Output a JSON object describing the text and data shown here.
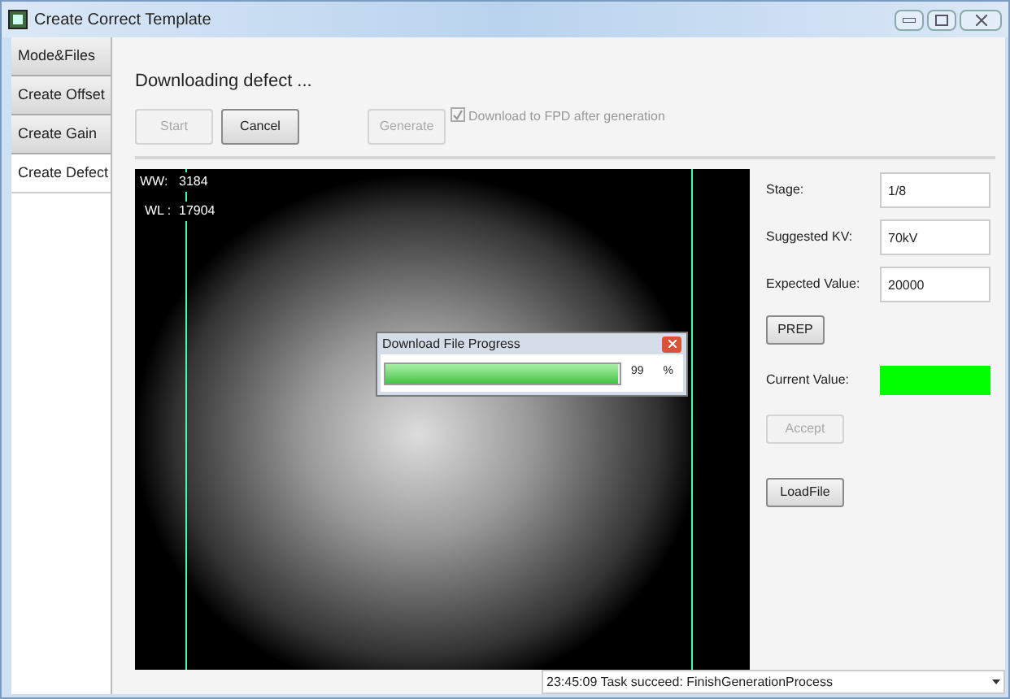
{
  "window": {
    "title": "Create Correct Template"
  },
  "tabs": [
    {
      "label": "Mode&Files",
      "selected": false
    },
    {
      "label": "Create Offset",
      "selected": false
    },
    {
      "label": "Create Gain",
      "selected": false
    },
    {
      "label": "Create Defect",
      "selected": true
    }
  ],
  "status_message": "Downloading defect ...",
  "toolbar": {
    "buttons": [
      {
        "label": "Start",
        "disabled": true
      },
      {
        "label": "Cancel",
        "disabled": false
      },
      {
        "label": "Generate",
        "disabled": true
      }
    ],
    "checkbox": {
      "label": "Download to FPD after generation",
      "checked": true,
      "disabled": true
    }
  },
  "image_overlay": [
    {
      "label": "WW:",
      "value": "3184"
    },
    {
      "label": "WL :",
      "value": "17904"
    }
  ],
  "progress_dialog": {
    "title": "Download File Progress",
    "level": 0.99,
    "reading": "99",
    "unit": "%"
  },
  "fields": [
    {
      "label": "Stage:",
      "value": "1/8"
    },
    {
      "label": "Suggested KV:",
      "value": "70kV"
    },
    {
      "label": "Expected Value:",
      "value": "20000"
    }
  ],
  "prep_button": {
    "label": "PREP",
    "disabled": false
  },
  "current_value": {
    "label": "Current Value:",
    "color": "#00ff00"
  },
  "accept_button": {
    "label": "Accept",
    "disabled": true
  },
  "loadfile_button": {
    "label": "LoadFile",
    "disabled": false
  },
  "status_bar": {
    "text": "23:45:09 Task succeed: FinishGenerationProcess"
  }
}
